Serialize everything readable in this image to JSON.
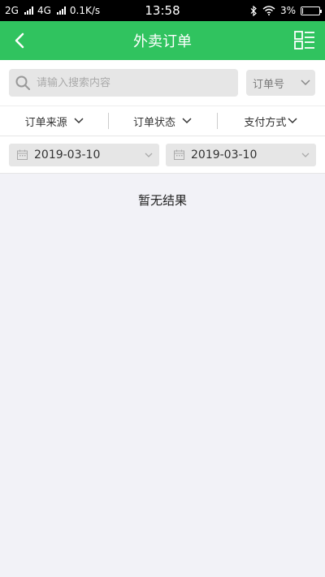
{
  "status_bar": {
    "network1": "2G",
    "network2": "4G",
    "speed": "0.1K/s",
    "time": "13:58",
    "battery": "3%",
    "battery_level": 0.03
  },
  "nav": {
    "title": "外卖订单",
    "back_icon": "chevron-left-icon",
    "menu_icon": "grid-list-icon"
  },
  "search": {
    "placeholder": "请输入搜索内容",
    "value": "",
    "type_selected": "订单号"
  },
  "filters": [
    {
      "label": "订单来源"
    },
    {
      "label": "订单状态"
    },
    {
      "label": "支付方式"
    }
  ],
  "dates": {
    "start": "2019-03-10",
    "end": "2019-03-10"
  },
  "empty_text": "暂无结果",
  "colors": {
    "brand": "#30c35f",
    "background": "#f2f2f7"
  }
}
